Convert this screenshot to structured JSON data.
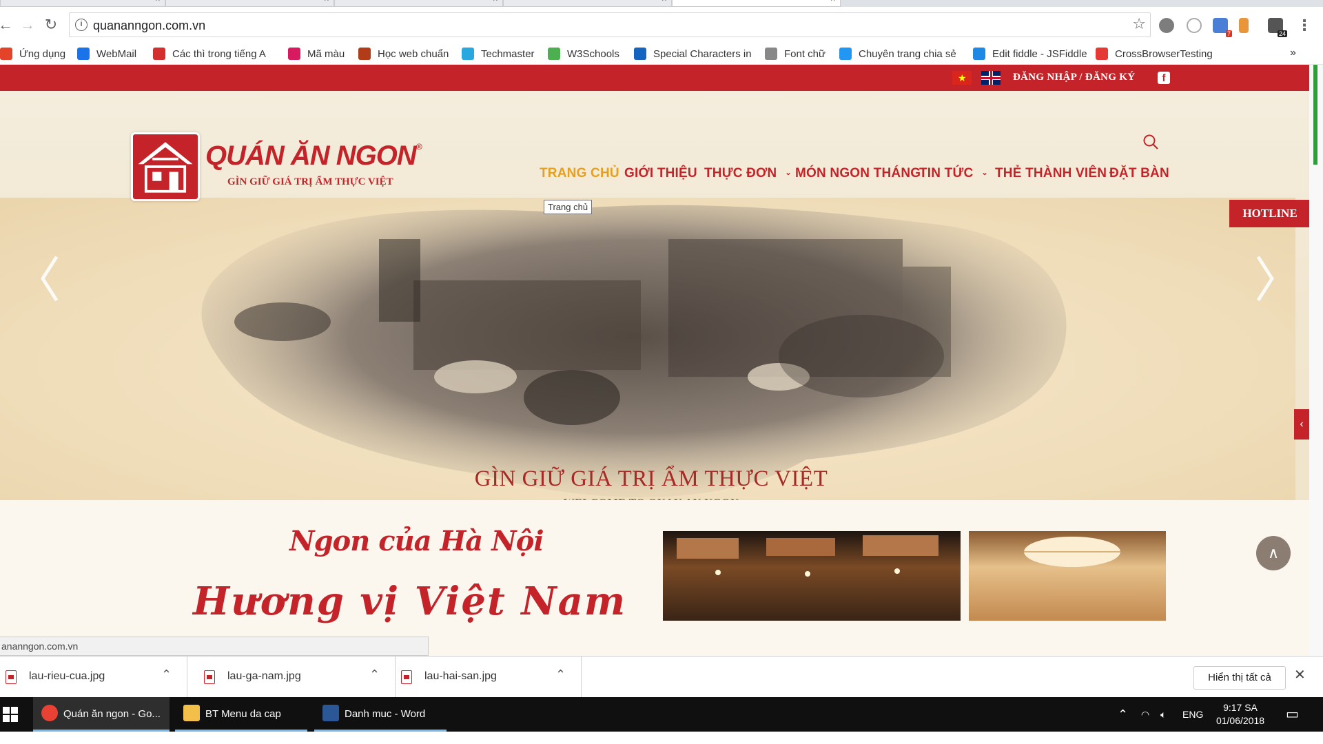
{
  "browser": {
    "url": "quananngon.com.vn",
    "bookmarks": [
      {
        "label": "Ứng dụng",
        "icon": "apps-icon",
        "color": "#e24329"
      },
      {
        "label": "WebMail",
        "icon": "mail-icon",
        "color": "#1a73e8"
      },
      {
        "label": "Các thì trong tiếng A",
        "icon": "x3-icon",
        "color": "#d32f2f"
      },
      {
        "label": "Mã màu",
        "icon": "v-icon",
        "color": "#d81b60"
      },
      {
        "label": "Học web chuẩn",
        "icon": "web-icon",
        "color": "#b23c17"
      },
      {
        "label": "Techmaster",
        "icon": "techmaster-icon",
        "color": "#29a8e0"
      },
      {
        "label": "W3Schools",
        "icon": "w3-icon",
        "color": "#4caf50"
      },
      {
        "label": "Special Characters in",
        "icon": "special-icon",
        "color": "#1565c0"
      },
      {
        "label": "Font chữ",
        "icon": "page-icon",
        "color": "#888888"
      },
      {
        "label": "Chuyên trang chia sẻ",
        "icon": "globe-icon",
        "color": "#2196f3"
      },
      {
        "label": "Edit fiddle - JSFiddle",
        "icon": "cloud-icon",
        "color": "#1e88e5"
      },
      {
        "label": "CrossBrowserTesting",
        "icon": "cbt-icon",
        "color": "#e53935"
      }
    ],
    "more": "»"
  },
  "site": {
    "topbar": {
      "login": "ĐĂNG NHẬP / ĐĂNG KÝ",
      "fb": "f"
    },
    "logo": {
      "name": "QUÁN ĂN NGON",
      "reg": "®",
      "slogan": "GÌN GIỮ GIÁ TRỊ ẨM THỰC VIỆT"
    },
    "nav": [
      {
        "label": "TRANG CHỦ",
        "active": true
      },
      {
        "label": "GIỚI THIỆU"
      },
      {
        "label": "THỰC ĐƠN",
        "caret": "⌄"
      },
      {
        "label": "MÓN NGON THÁNG"
      },
      {
        "label": "TIN TỨC",
        "caret": "⌄"
      },
      {
        "label": "THẺ THÀNH VIÊN"
      },
      {
        "label": "ĐẶT BÀN"
      }
    ],
    "tooltip": "Trang chủ",
    "hotline": "HOTLINE",
    "hero": {
      "tagline": "GÌN GIỮ GIÁ TRỊ ẨM THỰC VIỆT",
      "welcome": "WELCOME TO QUAN AN NGON",
      "prev": "〈",
      "next": "〉",
      "down": "⌄"
    },
    "below": {
      "title1": "Ngon của Hà Nội",
      "title2": "Hương vị Việt Nam",
      "to_top": "∧"
    },
    "status_url": "ananngon.com.vn"
  },
  "downloads": {
    "files": [
      {
        "name": "lau-rieu-cua.jpg"
      },
      {
        "name": "lau-ga-nam.jpg"
      },
      {
        "name": "lau-hai-san.jpg"
      }
    ],
    "show_all": "Hiển thị tất cả",
    "close": "✕"
  },
  "taskbar": {
    "tasks": [
      {
        "label": "Quán ăn ngon - Go...",
        "icon": "chrome-icon",
        "active": true
      },
      {
        "label": "BT Menu da cap",
        "icon": "folder-icon"
      },
      {
        "label": "Danh muc - Word",
        "icon": "word-icon"
      }
    ],
    "lang": "ENG",
    "time": "9:17 SA",
    "date": "01/06/2018"
  },
  "colors": {
    "brand_red": "#c42429",
    "nav_active": "#e4a020",
    "taskbar": "#101010"
  }
}
